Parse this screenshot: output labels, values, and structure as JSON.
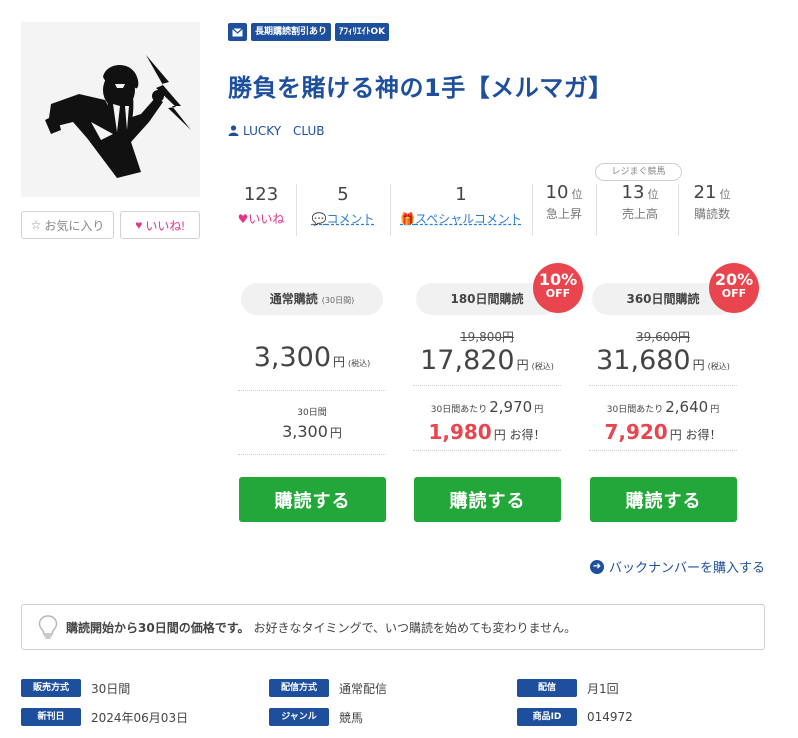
{
  "tags": [
    "長期購読割引あり",
    "ｱﾌｨﾘｴｲﾄOK"
  ],
  "title": "勝負を賭ける神の1手【メルマガ】",
  "author": "LUCKY　CLUB",
  "buttons": {
    "favorite": "お気に入り",
    "like": "いいね!"
  },
  "stats": {
    "likes": {
      "num": "123",
      "label": "いいね"
    },
    "comments": {
      "num": "5",
      "label": "コメント"
    },
    "special": {
      "num": "1",
      "label": "スペシャルコメント"
    }
  },
  "rank_badge": "レジまぐ競馬",
  "ranks": [
    {
      "num": "10",
      "unit": "位",
      "label": "急上昇"
    },
    {
      "num": "13",
      "unit": "位",
      "label": "売上高"
    },
    {
      "num": "21",
      "unit": "位",
      "label": "購読数"
    }
  ],
  "plans": [
    {
      "name": "通常購読",
      "sub": "(30日間)",
      "price": "3,300",
      "unit": "円",
      "tax": "(税込)",
      "per_label": "30日間",
      "per_value": "3,300",
      "per_unit": "円",
      "buy": "購読する"
    },
    {
      "name": "180日間購読",
      "discount": "10%",
      "off": "OFF",
      "orig": "19,800円",
      "price": "17,820",
      "unit": "円",
      "tax": "(税込)",
      "per_prefix": "30日間あたり",
      "per_value": "2,970",
      "per_unit": "円",
      "save": "1,980",
      "save_unit": "円",
      "save_text": "お得！",
      "buy": "購読する"
    },
    {
      "name": "360日間購読",
      "discount": "20%",
      "off": "OFF",
      "orig": "39,600円",
      "price": "31,680",
      "unit": "円",
      "tax": "(税込)",
      "per_prefix": "30日間あたり",
      "per_value": "2,640",
      "per_unit": "円",
      "save": "7,920",
      "save_unit": "円",
      "save_text": "お得！",
      "buy": "購読する"
    }
  ],
  "backnumber": "バックナンバーを購入する",
  "notice": {
    "bold": "購読開始から30日間の価格です。",
    "text": "お好きなタイミングで、いつ購読を始めても変わりません。"
  },
  "meta": [
    {
      "key": "販売方式",
      "value": "30日間"
    },
    {
      "key": "配信方式",
      "value": "通常配信"
    },
    {
      "key": "配信",
      "value": "月1回"
    },
    {
      "key": "新刊日",
      "value": "2024年06月03日"
    },
    {
      "key": "ジャンル",
      "value": "競馬"
    },
    {
      "key": "商品ID",
      "value": "014972"
    }
  ],
  "colors": {
    "brand": "#1e4f9c",
    "buy": "#21a838",
    "discount": "#e8454f",
    "like": "#e4358b"
  },
  "icons": [
    "mail-icon",
    "user-icon",
    "heart-icon",
    "star-icon",
    "comment-icon",
    "gift-icon",
    "arrow-right-icon",
    "lightbulb-icon"
  ]
}
